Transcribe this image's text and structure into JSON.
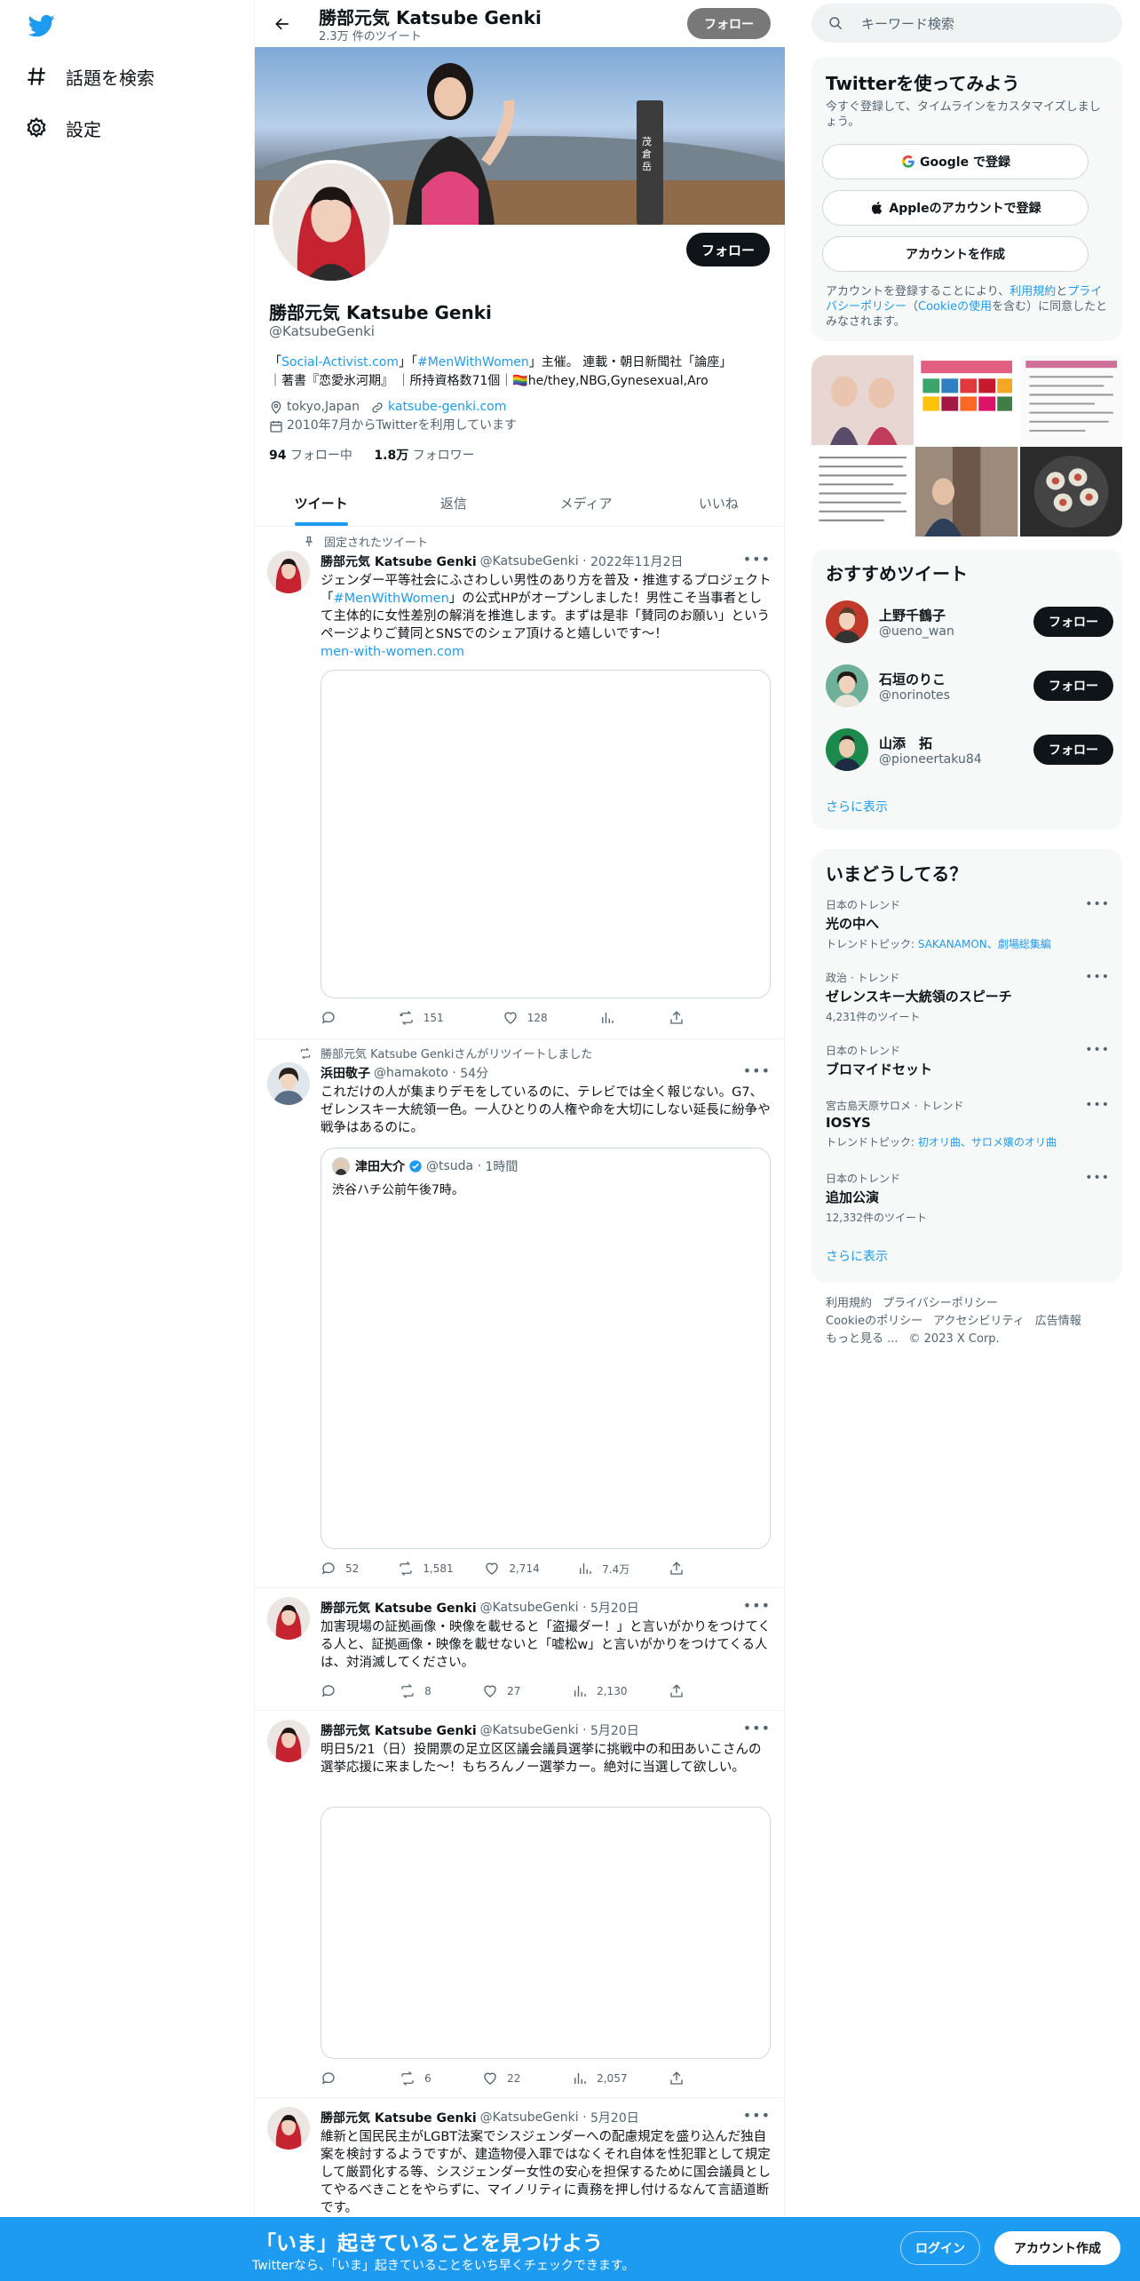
{
  "nav": {
    "explore_label": "話題を検索",
    "settings_label": "設定"
  },
  "header": {
    "name": "勝部元気 Katsube Genki",
    "tweet_count": "2.3万 件のツイート",
    "follow_label": "フォロー"
  },
  "banner": {
    "post_text": "茂倉岳"
  },
  "profile": {
    "name": "勝部元気 Katsube Genki",
    "handle": "@KatsubeGenki",
    "follow_label": "フォロー",
    "bio_prefix": "「",
    "bio_link1": "Social-Activist.com",
    "bio_mid1": "」「",
    "bio_link2": "#MenWithWomen",
    "bio_rest1": "」主催。 連載・朝日新聞社「論座」",
    "bio_line2": "｜著書『恋愛氷河期』 ｜所持資格数71個｜🏳️‍🌈he/they,NBG,Gynesexual,Aro",
    "location": "tokyo,Japan",
    "website": "katsube-genki.com",
    "joined": "2010年7月からTwitterを利用しています",
    "following_count": "94",
    "following_label": "フォロー中",
    "followers_count": "1.8万",
    "followers_label": "フォロワー"
  },
  "tabs": [
    "ツイート",
    "返信",
    "メディア",
    "いいね"
  ],
  "tweets": [
    {
      "context": "固定されたツイート",
      "name": "勝部元気 Katsube Genki",
      "handle": "@KatsubeGenki",
      "time": "2022年11月2日",
      "text_a": "ジェンダー平等社会にふさわしい男性のあり方を普及・推進するプロジェクト「",
      "text_link": "#MenWithWomen",
      "text_b": "」の公式HPがオープンしました！男性こそ当事者として主体的に女性差別の解消を推進します。まずは是非「賛同のお願い」というページよりご賛同とSNSでのシェア頂けると嬉しいです〜！",
      "url": "men-with-women.com",
      "replies": "",
      "retweets": "151",
      "likes": "128",
      "views": ""
    },
    {
      "context": "勝部元気 Katsube Genkiさんがリツイートしました",
      "name": "浜田敬子",
      "handle": "@hamakoto",
      "time": "54分",
      "text": "これだけの人が集まりデモをしているのに、テレビでは全く報じない。G7、ゼレンスキー大統領一色。一人ひとりの人権や命を大切にしない延長に紛争や戦争はあるのに。",
      "quote_name": "津田大介",
      "quote_handle": "@tsuda",
      "quote_time": "1時間",
      "quote_text": "渋谷ハチ公前午後7時。",
      "replies": "52",
      "retweets": "1,581",
      "likes": "2,714",
      "views": "7.4万"
    },
    {
      "name": "勝部元気 Katsube Genki",
      "handle": "@KatsubeGenki",
      "time": "5月20日",
      "text": "加害現場の証拠画像・映像を載せると「盗撮ダー！」と言いがかりをつけてくる人と、証拠画像・映像を載せないと「嘘松w」と言いがかりをつけてくる人は、対消滅してください。",
      "replies": "",
      "retweets": "8",
      "likes": "27",
      "views": "2,130"
    },
    {
      "name": "勝部元気 Katsube Genki",
      "handle": "@KatsubeGenki",
      "time": "5月20日",
      "text": "明日5/21（日）投開票の足立区区議会議員選挙に挑戦中の和田あいこさんの選挙応援に来ました〜！もちろんノー選挙カー。絶対に当選して欲しい。",
      "replies": "",
      "retweets": "6",
      "likes": "22",
      "views": "2,057"
    },
    {
      "name": "勝部元気 Katsube Genki",
      "handle": "@KatsubeGenki",
      "time": "5月20日",
      "text": "維新と国民民主がLGBT法案でシスジェンダーへの配慮規定を盛り込んだ独自案を検討するようですが、建造物侵入罪ではなくそれ自体を性犯罪として規定して厳罰化する等、シスジェンダー女性の安心を担保するために国会議員としてやるべきことをやらずに、マイノリティに責務を押し付けるなんて言語道断です。"
    }
  ],
  "search": {
    "placeholder": "キーワード検索"
  },
  "signup": {
    "title": "Twitterを使ってみよう",
    "subtitle": "今すぐ登録して、タイムラインをカスタマイズしましょう。",
    "google_label": "Google で登録",
    "apple_label": "Appleのアカウントで登録",
    "create_label": "アカウントを作成",
    "legal_a": "アカウントを登録することにより、",
    "legal_terms": "利用規約",
    "legal_and": "と",
    "legal_privacy": "プライバシーポリシー",
    "legal_b": "（",
    "legal_cookie": "Cookieの使用",
    "legal_c": "を含む）に同意したとみなされます。"
  },
  "recommended": {
    "title": "おすすめツイート",
    "follow_label": "フォロー",
    "show_more": "さらに表示",
    "users": [
      {
        "name": "上野千鶴子",
        "handle": "@ueno_wan"
      },
      {
        "name": "石垣のりこ",
        "handle": "@norinotes"
      },
      {
        "name": "山添　拓",
        "handle": "@pioneertaku84"
      }
    ]
  },
  "trends": {
    "title": "いまどうしてる？",
    "show_more": "さらに表示",
    "items": [
      {
        "category": "日本のトレンド",
        "name": "光の中へ",
        "meta_prefix": "トレンドトピック: ",
        "meta_links": "SAKANAMON、劇場総集編"
      },
      {
        "category": "政治 · トレンド",
        "name": "ゼレンスキー大統領のスピーチ",
        "meta": "4,231件のツイート"
      },
      {
        "category": "日本のトレンド",
        "name": "ブロマイドセット",
        "meta": ""
      },
      {
        "category": "宮古島天原サロメ · トレンド",
        "name": "IOSYS",
        "meta_prefix": "トレンドトピック: ",
        "meta_links": "初オリ曲、サロメ嬢のオリ曲"
      },
      {
        "category": "日本のトレンド",
        "name": "追加公演",
        "meta": "12,332件のツイート"
      }
    ]
  },
  "footer": {
    "terms": "利用規約",
    "privacy": "プライバシーポリシー",
    "cookie": "Cookieのポリシー",
    "accessibility": "アクセシビリティ",
    "ads": "広告情報",
    "more": "もっと見る ...",
    "copyright": "© 2023 X Corp."
  },
  "bottom_bar": {
    "title": "「いま」起きていることを見つけよう",
    "subtitle": "Twitterなら、「いま」起きていることをいち早くチェックできます。",
    "login_label": "ログイン",
    "signup_label": "アカウント作成"
  },
  "colors": {
    "accent": "#1d9bf0",
    "text": "#0f1419",
    "muted": "#536471"
  }
}
